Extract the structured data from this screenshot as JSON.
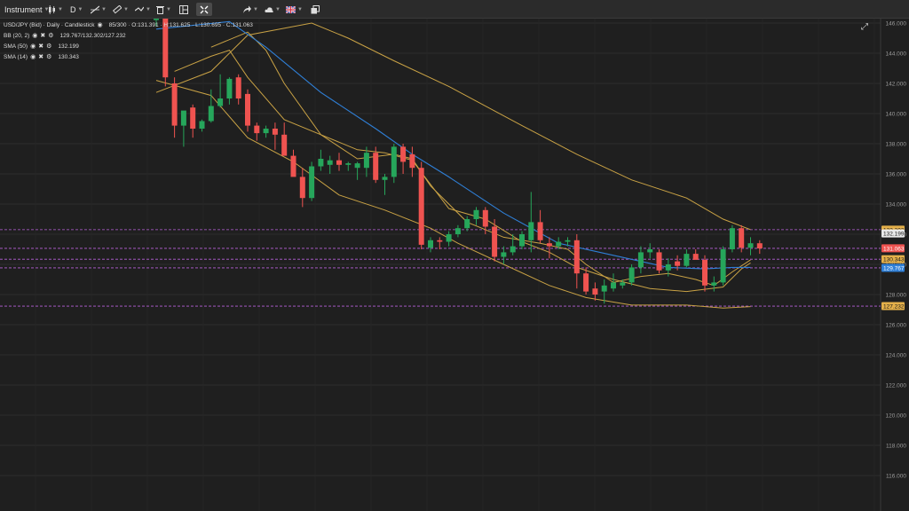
{
  "toolbar": {
    "instrument": "Instrument",
    "timeframe": "D"
  },
  "legend": {
    "symbol_line": "USD/JPY (Bid) · Daily · Candlestick",
    "ohlc": "85/300 · O:131.391 · H:131.625 · L:130.695 · C:131.063",
    "indicators": [
      {
        "label": "BB (20, 2)",
        "value": "129.767/132.302/127.232"
      },
      {
        "label": "SMA (50)",
        "value": "132.199"
      },
      {
        "label": "SMA (14)",
        "value": "130.343"
      }
    ]
  },
  "price_badges": [
    {
      "text": "132.302",
      "value": 132.302,
      "color": "#e4b04a",
      "text_color": "#1a1a1a"
    },
    {
      "text": "132.199",
      "value": 132.05,
      "color": "#e9e9e9",
      "text_color": "#1a1a1a"
    },
    {
      "text": "131.063",
      "value": 131.063,
      "color": "#ef5350",
      "text_color": "#ffffff"
    },
    {
      "text": "130.343",
      "value": 130.343,
      "color": "#e4b04a",
      "text_color": "#1a1a1a"
    },
    {
      "text": "129.767",
      "value": 129.767,
      "color": "#2f7fd6",
      "text_color": "#ffffff"
    },
    {
      "text": "127.232",
      "value": 127.232,
      "color": "#e4b04a",
      "text_color": "#1a1a1a"
    }
  ],
  "chart_data": {
    "type": "candlestick",
    "title": "USD/JPY (Bid) · Daily · Candlestick",
    "ylim": [
      115,
      147.5
    ],
    "y_ticks": [
      "116.000",
      "118.000",
      "120.000",
      "122.000",
      "124.000",
      "126.000",
      "128.000",
      "130.000",
      "132.000",
      "134.000",
      "136.000",
      "138.000",
      "140.000",
      "142.000",
      "144.000",
      "146.000"
    ],
    "colors": {
      "up": "#26a65b",
      "down": "#ef5350",
      "bb": "#c9a245",
      "sma50": "#2f7fd6",
      "sma14": "#c9a245",
      "level": "#b760d9"
    },
    "candles": [
      {
        "o": 146.2,
        "h": 147.2,
        "l": 145.8,
        "c": 146.5
      },
      {
        "o": 147.0,
        "h": 147.4,
        "l": 141.8,
        "c": 142.4
      },
      {
        "o": 142.0,
        "h": 142.4,
        "l": 138.4,
        "c": 139.2
      },
      {
        "o": 139.2,
        "h": 139.8,
        "l": 137.8,
        "c": 140.2
      },
      {
        "o": 140.4,
        "h": 140.6,
        "l": 138.4,
        "c": 139.0
      },
      {
        "o": 139.0,
        "h": 139.6,
        "l": 138.8,
        "c": 139.5
      },
      {
        "o": 139.5,
        "h": 141.6,
        "l": 139.4,
        "c": 140.5
      },
      {
        "o": 140.5,
        "h": 142.6,
        "l": 140.4,
        "c": 141.0
      },
      {
        "o": 141.0,
        "h": 142.4,
        "l": 140.6,
        "c": 142.3
      },
      {
        "o": 142.4,
        "h": 142.6,
        "l": 140.6,
        "c": 141.0
      },
      {
        "o": 141.3,
        "h": 141.6,
        "l": 138.8,
        "c": 139.2
      },
      {
        "o": 139.2,
        "h": 139.4,
        "l": 138.2,
        "c": 138.7
      },
      {
        "o": 138.7,
        "h": 139.2,
        "l": 138.4,
        "c": 139.0
      },
      {
        "o": 139.0,
        "h": 139.4,
        "l": 137.6,
        "c": 138.6
      },
      {
        "o": 138.6,
        "h": 139.4,
        "l": 138.2,
        "c": 137.2
      },
      {
        "o": 137.2,
        "h": 137.6,
        "l": 136.2,
        "c": 135.8
      },
      {
        "o": 135.8,
        "h": 136.4,
        "l": 133.8,
        "c": 134.4
      },
      {
        "o": 134.4,
        "h": 136.8,
        "l": 134.2,
        "c": 136.5
      },
      {
        "o": 136.5,
        "h": 137.6,
        "l": 136.2,
        "c": 137.0
      },
      {
        "o": 136.6,
        "h": 137.2,
        "l": 136.0,
        "c": 136.9
      },
      {
        "o": 136.9,
        "h": 137.4,
        "l": 136.2,
        "c": 136.6
      },
      {
        "o": 136.6,
        "h": 136.8,
        "l": 136.2,
        "c": 136.7
      },
      {
        "o": 136.4,
        "h": 136.8,
        "l": 135.6,
        "c": 136.7
      },
      {
        "o": 136.4,
        "h": 137.8,
        "l": 135.8,
        "c": 137.4
      },
      {
        "o": 137.4,
        "h": 137.8,
        "l": 135.4,
        "c": 135.6
      },
      {
        "o": 135.6,
        "h": 136.0,
        "l": 134.6,
        "c": 135.8
      },
      {
        "o": 135.8,
        "h": 138.0,
        "l": 135.4,
        "c": 137.8
      },
      {
        "o": 137.8,
        "h": 138.0,
        "l": 136.0,
        "c": 136.8
      },
      {
        "o": 137.3,
        "h": 137.8,
        "l": 135.8,
        "c": 136.4
      },
      {
        "o": 136.4,
        "h": 136.8,
        "l": 131.0,
        "c": 131.3
      },
      {
        "o": 131.1,
        "h": 131.8,
        "l": 130.8,
        "c": 131.6
      },
      {
        "o": 131.6,
        "h": 131.8,
        "l": 131.0,
        "c": 131.5
      },
      {
        "o": 131.5,
        "h": 132.2,
        "l": 131.2,
        "c": 132.0
      },
      {
        "o": 132.0,
        "h": 132.6,
        "l": 131.8,
        "c": 132.4
      },
      {
        "o": 132.4,
        "h": 133.2,
        "l": 132.2,
        "c": 133.0
      },
      {
        "o": 133.0,
        "h": 133.8,
        "l": 132.6,
        "c": 133.6
      },
      {
        "o": 133.6,
        "h": 133.8,
        "l": 132.0,
        "c": 132.5
      },
      {
        "o": 132.5,
        "h": 133.0,
        "l": 130.2,
        "c": 130.5
      },
      {
        "o": 130.5,
        "h": 131.2,
        "l": 130.0,
        "c": 130.8
      },
      {
        "o": 130.8,
        "h": 132.0,
        "l": 130.6,
        "c": 131.2
      },
      {
        "o": 131.2,
        "h": 132.2,
        "l": 131.0,
        "c": 132.0
      },
      {
        "o": 131.6,
        "h": 134.8,
        "l": 130.8,
        "c": 132.8
      },
      {
        "o": 132.8,
        "h": 133.6,
        "l": 131.4,
        "c": 131.6
      },
      {
        "o": 131.4,
        "h": 131.8,
        "l": 130.4,
        "c": 131.2
      },
      {
        "o": 131.2,
        "h": 131.8,
        "l": 131.0,
        "c": 131.5
      },
      {
        "o": 131.5,
        "h": 131.8,
        "l": 131.2,
        "c": 131.6
      },
      {
        "o": 131.6,
        "h": 132.0,
        "l": 128.4,
        "c": 129.4
      },
      {
        "o": 129.4,
        "h": 129.8,
        "l": 128.0,
        "c": 128.2
      },
      {
        "o": 128.4,
        "h": 128.8,
        "l": 127.6,
        "c": 128.0
      },
      {
        "o": 128.2,
        "h": 129.0,
        "l": 127.4,
        "c": 128.6
      },
      {
        "o": 128.4,
        "h": 129.4,
        "l": 128.2,
        "c": 128.8
      },
      {
        "o": 128.6,
        "h": 129.0,
        "l": 128.4,
        "c": 128.8
      },
      {
        "o": 128.8,
        "h": 130.0,
        "l": 128.6,
        "c": 129.8
      },
      {
        "o": 129.8,
        "h": 131.2,
        "l": 129.4,
        "c": 130.8
      },
      {
        "o": 130.8,
        "h": 131.4,
        "l": 130.4,
        "c": 131.0
      },
      {
        "o": 130.8,
        "h": 131.0,
        "l": 129.4,
        "c": 129.6
      },
      {
        "o": 129.6,
        "h": 130.4,
        "l": 129.2,
        "c": 130.0
      },
      {
        "o": 130.2,
        "h": 130.6,
        "l": 129.6,
        "c": 129.9
      },
      {
        "o": 129.9,
        "h": 131.0,
        "l": 129.8,
        "c": 130.7
      },
      {
        "o": 130.7,
        "h": 131.0,
        "l": 130.4,
        "c": 130.3
      },
      {
        "o": 130.3,
        "h": 130.6,
        "l": 128.2,
        "c": 128.6
      },
      {
        "o": 128.6,
        "h": 129.2,
        "l": 128.2,
        "c": 128.8
      },
      {
        "o": 128.8,
        "h": 131.2,
        "l": 128.6,
        "c": 131.0
      },
      {
        "o": 131.0,
        "h": 132.6,
        "l": 130.8,
        "c": 132.4
      },
      {
        "o": 132.4,
        "h": 132.6,
        "l": 130.8,
        "c": 131.1
      },
      {
        "o": 131.1,
        "h": 131.8,
        "l": 130.6,
        "c": 131.4
      },
      {
        "o": 131.4,
        "h": 131.6,
        "l": 130.7,
        "c": 131.06
      }
    ],
    "bb_upper": [
      [
        0,
        141.4
      ],
      [
        6,
        142.8
      ],
      [
        10,
        145.2
      ],
      [
        17,
        146.0
      ],
      [
        21,
        145.0
      ],
      [
        26,
        143.5
      ],
      [
        32,
        141.8
      ],
      [
        40,
        139.2
      ],
      [
        46,
        137.3
      ],
      [
        52,
        135.6
      ],
      [
        58,
        134.4
      ],
      [
        62,
        133.0
      ],
      [
        65,
        132.3
      ]
    ],
    "bb_lower": [
      [
        0,
        142.2
      ],
      [
        6,
        141.2
      ],
      [
        10,
        138.4
      ],
      [
        15,
        136.8
      ],
      [
        20,
        134.6
      ],
      [
        25,
        133.6
      ],
      [
        30,
        132.4
      ],
      [
        33,
        131.4
      ],
      [
        38,
        130.0
      ],
      [
        43,
        128.6
      ],
      [
        47,
        127.8
      ],
      [
        52,
        127.3
      ],
      [
        58,
        127.3
      ],
      [
        62,
        127.1
      ],
      [
        65,
        127.2
      ]
    ],
    "bb_middle": [
      [
        2,
        142.8
      ],
      [
        6,
        143.8
      ],
      [
        8,
        144.2
      ],
      [
        10,
        142.4
      ],
      [
        14,
        139.6
      ],
      [
        18,
        138.6
      ],
      [
        22,
        137.6
      ],
      [
        25,
        137.4
      ],
      [
        28,
        136.9
      ],
      [
        32,
        133.7
      ],
      [
        36,
        133.0
      ],
      [
        40,
        131.5
      ],
      [
        43,
        130.8
      ],
      [
        46,
        129.8
      ],
      [
        50,
        129.0
      ],
      [
        54,
        128.4
      ],
      [
        58,
        128.2
      ],
      [
        62,
        128.5
      ],
      [
        64,
        129.7
      ],
      [
        65,
        130.1
      ]
    ],
    "sma50": [
      [
        0,
        145.6
      ],
      [
        8,
        146.1
      ],
      [
        12,
        144.4
      ],
      [
        18,
        141.4
      ],
      [
        24,
        139.0
      ],
      [
        28,
        137.3
      ],
      [
        32,
        135.8
      ],
      [
        38,
        133.4
      ],
      [
        44,
        131.4
      ],
      [
        50,
        130.6
      ],
      [
        56,
        129.8
      ],
      [
        60,
        129.7
      ],
      [
        63,
        129.8
      ],
      [
        65,
        129.8
      ]
    ],
    "sma14": [
      [
        6,
        144.4
      ],
      [
        10,
        145.4
      ],
      [
        12,
        144.2
      ],
      [
        14,
        142.0
      ],
      [
        18,
        138.6
      ],
      [
        22,
        137.0
      ],
      [
        26,
        137.3
      ],
      [
        28,
        137.0
      ],
      [
        30,
        135.2
      ],
      [
        34,
        132.8
      ],
      [
        38,
        131.8
      ],
      [
        42,
        131.4
      ],
      [
        45,
        131.0
      ],
      [
        47,
        130.0
      ],
      [
        50,
        128.8
      ],
      [
        53,
        129.2
      ],
      [
        56,
        129.4
      ],
      [
        59,
        129.0
      ],
      [
        61,
        128.6
      ],
      [
        63,
        129.5
      ],
      [
        65,
        130.3
      ]
    ],
    "levels": [
      132.302,
      131.063,
      130.343,
      129.767,
      127.232
    ]
  }
}
